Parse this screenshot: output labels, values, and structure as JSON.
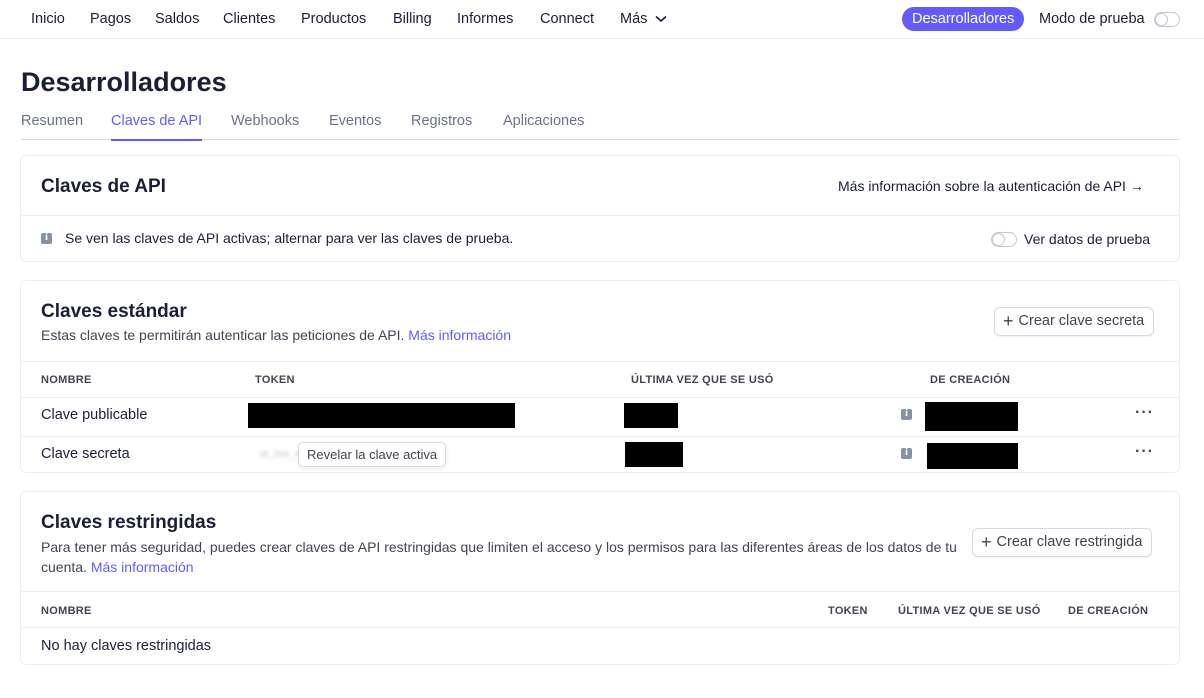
{
  "nav": {
    "items": [
      "Inicio",
      "Pagos",
      "Saldos",
      "Clientes",
      "Productos",
      "Billing",
      "Informes",
      "Connect",
      "Más"
    ],
    "developers": "Desarrolladores",
    "test_mode": "Modo de prueba"
  },
  "page": {
    "title": "Desarrolladores",
    "tabs": [
      "Resumen",
      "Claves de API",
      "Webhooks",
      "Eventos",
      "Registros",
      "Aplicaciones"
    ],
    "active_tab": "Claves de API"
  },
  "api_card": {
    "title": "Claves de API",
    "learn_more": "Más información sobre la autenticación de API →",
    "notice": "Se ven las claves de API activas; alternar para ver las claves de prueba.",
    "view_test_data": "Ver datos de prueba"
  },
  "standard": {
    "title": "Claves estándar",
    "subtitle": "Estas claves te permitirán autenticar las peticiones de API.",
    "more_info": "Más información",
    "create_button": "Crear clave secreta",
    "columns": [
      "NOMBRE",
      "TOKEN",
      "ÚLTIMA VEZ QUE SE USÓ",
      "DE CREACIÓN"
    ],
    "rows": [
      {
        "name": "Clave publicable"
      },
      {
        "name": "Clave secreta",
        "reveal": "Revelar la clave activa"
      }
    ]
  },
  "restricted": {
    "title": "Claves restringidas",
    "subtitle": "Para tener más seguridad, puedes crear claves de API restringidas que limiten el acceso y los permisos para las diferentes áreas de los datos de tu cuenta.",
    "more_info": "Más información",
    "create_button": "Crear clave restringida",
    "columns": [
      "NOMBRE",
      "TOKEN",
      "ÚLTIMA VEZ QUE SE USÓ",
      "DE CREACIÓN"
    ],
    "empty": "No hay claves restringidas"
  },
  "colors": {
    "accent": "#635bff",
    "text": "#1a1f36",
    "border": "#ebeef1"
  }
}
